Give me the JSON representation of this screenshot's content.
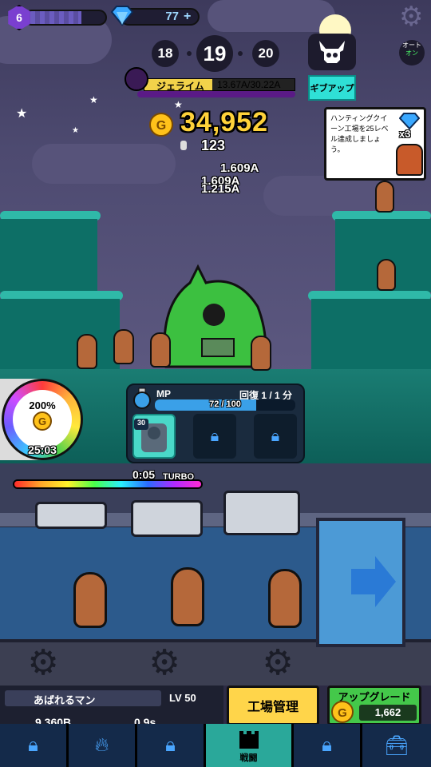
{
  "player": {
    "level": "6",
    "xp_progress": 0.7,
    "gems": "77",
    "gem_plus": "+"
  },
  "stages": {
    "prev": "18",
    "current": "19",
    "next": "20"
  },
  "auto": {
    "label_top": "オート",
    "label_bottom": "オン"
  },
  "boss": {
    "name": "ジェライム",
    "hp": "13.67A/30.22A",
    "hp_ratio": 0.45,
    "give_up": "ギブアップ"
  },
  "currency": {
    "coins": "34,952",
    "population": "123"
  },
  "damage_popups": [
    "1.609A",
    "1.609A",
    "1.215A"
  ],
  "quest": {
    "text": "ハンティングクイーン工場を25レベル達成しましょう。",
    "reward_multiplier": "x3"
  },
  "buff": {
    "percent": "200%",
    "timer": "25:03"
  },
  "mp": {
    "label": "MP",
    "regen": "回復 1 / 1 分",
    "current": 72,
    "max": 100,
    "text": "72 / 100",
    "skill_level": "30"
  },
  "turbo": {
    "timer": "0:05",
    "label": "TURBO",
    "ratio": 1.0
  },
  "character": {
    "name": "あばれるマン",
    "level": "LV 50",
    "stat1": "9.360B",
    "stat2": "0.9s"
  },
  "buttons": {
    "factory_management": "工場管理",
    "upgrade": "アップグレード",
    "upgrade_cost": "1,662"
  },
  "nav": {
    "tabs": [
      {
        "name": "locked",
        "label": ""
      },
      {
        "name": "fire",
        "label": ""
      },
      {
        "name": "locked",
        "label": ""
      },
      {
        "name": "battle",
        "label": "戦闘"
      },
      {
        "name": "locked",
        "label": ""
      },
      {
        "name": "chest",
        "label": ""
      }
    ]
  },
  "colors": {
    "coin": "#ffd23a",
    "gem": "#3aa8ff",
    "mp": "#3aa0e8",
    "active_tab": "#2aa89a",
    "give_up": "#2fe0d6",
    "factory_btn": "#ffd54a",
    "upgrade_btn": "#44c84a"
  }
}
